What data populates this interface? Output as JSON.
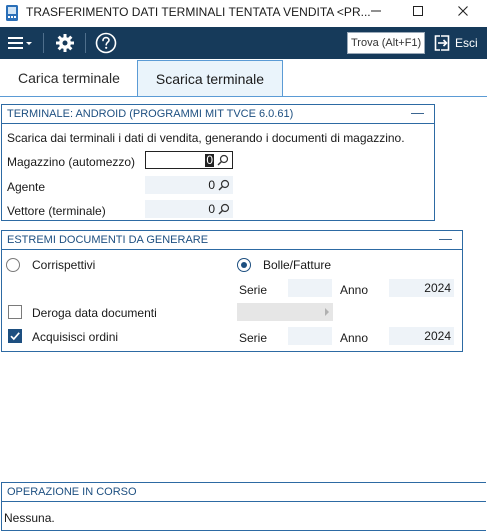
{
  "window": {
    "title": "TRASFERIMENTO DATI TERMINALI TENTATA VENDITA <PR...",
    "minimize_label": "—",
    "maximize_label": "☐",
    "close_label": "✕"
  },
  "toolbar": {
    "search_placeholder": "Trova (Alt+F1)",
    "exit_label": "Esci"
  },
  "tabs": [
    {
      "label": "Carica terminale",
      "active": false
    },
    {
      "label": "Scarica terminale",
      "active": true
    }
  ],
  "terminal_section": {
    "header": "TERMINALE: ANDROID (PROGRAMMI MIT TVCE 6.0.61)",
    "collapse": "—",
    "description": "Scarica dai terminali i dati di vendita, generando i documenti di magazzino.",
    "fields": [
      {
        "label": "Magazzino (automezzo)",
        "value": "0"
      },
      {
        "label": "Agente",
        "value": "0"
      },
      {
        "label": "Vettore (terminale)",
        "value": "0"
      }
    ]
  },
  "documents_section": {
    "header": "ESTREMI DOCUMENTI DA GENERARE",
    "collapse": "—",
    "radio_corrispettivi": "Corrispettivi",
    "radio_bolle": "Bolle/Fatture",
    "selected_radio": "Bolle/Fatture",
    "serie_label": "Serie",
    "anno_label": "Anno",
    "anno_value_1": "2024",
    "deroga_label": "Deroga data documenti",
    "deroga_checked": false,
    "acquisisci_label": "Acquisisci ordini",
    "acquisisci_checked": true,
    "serie_label_2": "Serie",
    "anno_label_2": "Anno",
    "anno_value_2": "2024"
  },
  "operation_section": {
    "header": "OPERAZIONE IN CORSO",
    "status": "Nessuna."
  },
  "colors": {
    "toolbar_bg": "#163a5a",
    "accent": "#1d4f80",
    "active_tab_bg": "#eaf4fb"
  }
}
